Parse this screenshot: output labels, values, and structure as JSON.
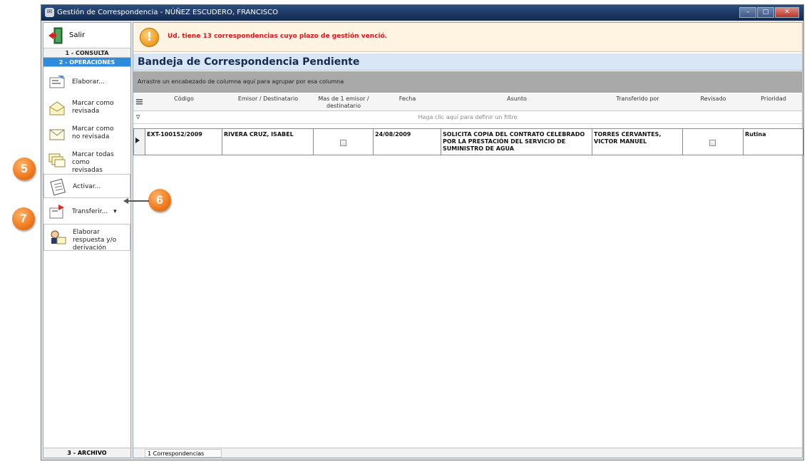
{
  "window": {
    "title": "Gestión de Correspondencia - NÚÑEZ ESCUDERO, FRANCISCO"
  },
  "sidebar": {
    "salir": "Salir",
    "consulta": "1 - CONSULTA",
    "operaciones": "2 - OPERACIONES",
    "archivo": "3 - ARCHIVO",
    "items": [
      {
        "label": "Elaborar...",
        "icon": "compose-icon"
      },
      {
        "label": "Marcar como revisada",
        "icon": "envelope-open-icon"
      },
      {
        "label": "Marcar como no revisada",
        "icon": "envelope-closed-icon"
      },
      {
        "label": "Marcar todas como revisadas",
        "icon": "envelopes-icon"
      },
      {
        "label": "Activar...",
        "icon": "clipboard-icon"
      },
      {
        "label": "Transferir...",
        "icon": "transfer-icon",
        "dropdown": "▾"
      },
      {
        "label": "Elaborar respuesta y/o derivación",
        "icon": "reply-icon"
      }
    ]
  },
  "alert": {
    "message": "Ud. tiene 13 correspondencias cuyo plazo de gestión venció."
  },
  "grid": {
    "title": "Bandeja de Correspondencia Pendiente",
    "groupby_hint": "Arrastre un encabezado de columna aquí para agrupar por esa columna",
    "filter_hint": "Haga clic aquí para definir un filtro",
    "columns": [
      "Código",
      "Emisor / Destinatario",
      "Mas de 1 emisor / destinatario",
      "Fecha",
      "Asunto",
      "Transferido por",
      "Revisado",
      "Prioridad"
    ],
    "rows": [
      {
        "codigo": "EXT-100152/2009",
        "emisor": "RIVERA CRUZ, ISABEL",
        "mas_de_uno": false,
        "fecha": "24/08/2009",
        "asunto": "SOLICITA COPIA DEL CONTRATO CELEBRADO POR LA PRESTACIÓN DEL SERVICIO DE SUMINISTRO DE AGUA",
        "transferido_por": "TORRES CERVANTES, VICTOR MANUEL",
        "revisado": false,
        "prioridad": "Rutina"
      }
    ],
    "status": "1 Correspondencias"
  },
  "callouts": [
    "5",
    "6",
    "7"
  ]
}
